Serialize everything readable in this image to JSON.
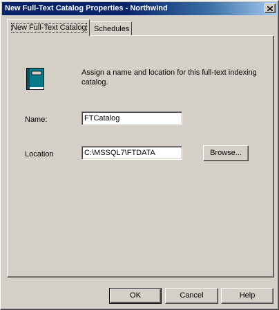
{
  "window": {
    "title": "New Full-Text Catalog Properties - Northwind",
    "close_glyph": "✕"
  },
  "tabs": [
    {
      "label": "New Full-Text Catalog",
      "active": true
    },
    {
      "label": "Schedules",
      "active": false
    }
  ],
  "panel": {
    "icon": "catalog-book-icon",
    "description": "Assign a name and location for this full-text indexing catalog.",
    "name_label": "Name:",
    "name_value": "FTCatalog",
    "location_label": "Location",
    "location_value": "C:\\MSSQL7\\FTDATA",
    "browse_label": "Browse..."
  },
  "buttons": {
    "ok": "OK",
    "cancel": "Cancel",
    "help": "Help"
  },
  "colors": {
    "titlebar_start": "#0a246a",
    "titlebar_end": "#a6caf0",
    "face": "#d4d0c8",
    "book": "#0a7a8a"
  }
}
